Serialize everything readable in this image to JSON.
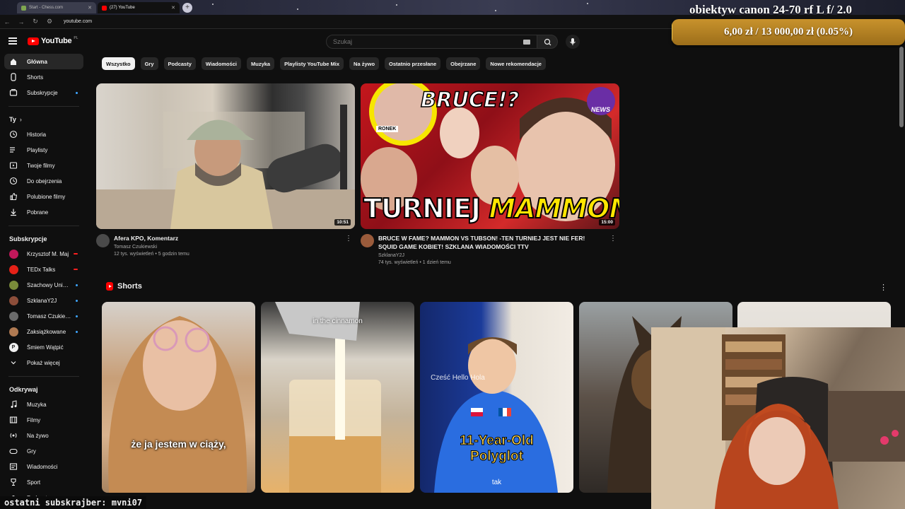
{
  "browser": {
    "tabs": [
      {
        "label": "Start - Chess.com",
        "active": false
      },
      {
        "label": "(27) YouTube",
        "active": true
      }
    ],
    "url": "youtube.com"
  },
  "overlay": {
    "title": "obiektyw canon 24-70 rf L f/ 2.0",
    "goal_text": "6,00 zł / 13 000,00 zł (0.05%)",
    "goal_progress_percent": 0.05,
    "last_subscriber": "ostatni subskrajber: mvni07"
  },
  "youtube": {
    "logo": "YouTube",
    "country_code": "PL",
    "search_placeholder": "Szukaj"
  },
  "sidebar": {
    "main": [
      {
        "label": "Główna",
        "icon": "home-icon",
        "active": true
      },
      {
        "label": "Shorts",
        "icon": "shorts-icon"
      },
      {
        "label": "Subskrypcje",
        "icon": "subscriptions-icon",
        "dot": true
      }
    ],
    "you_heading": "Ty",
    "you": [
      {
        "label": "Historia",
        "icon": "history-icon"
      },
      {
        "label": "Playlisty",
        "icon": "playlists-icon"
      },
      {
        "label": "Twoje filmy",
        "icon": "your-videos-icon"
      },
      {
        "label": "Do obejrzenia",
        "icon": "watch-later-icon"
      },
      {
        "label": "Polubione filmy",
        "icon": "like-icon"
      },
      {
        "label": "Pobrane",
        "icon": "download-icon"
      }
    ],
    "subs_heading": "Subskrypcje",
    "subs": [
      {
        "label": "Krzysztof M. Maj",
        "color": "#c2185b",
        "live": true
      },
      {
        "label": "TEDx Talks",
        "color": "#e62117",
        "live": true
      },
      {
        "label": "Szachowy Uniwe...",
        "color": "#7a8b3a",
        "dot": true
      },
      {
        "label": "SzklanaY2J",
        "color": "#8d4e3a",
        "dot": true
      },
      {
        "label": "Tomasz Czukiew...",
        "color": "#6b6b6b",
        "dot": true
      },
      {
        "label": "Zaksiążkowane",
        "color": "#b07a52",
        "dot": true
      },
      {
        "label": "Śmiem Wątpić",
        "color": "#f1f1f1",
        "letter": "P"
      },
      {
        "label": "Pokaż więcej",
        "icon": "chevron-down-icon"
      }
    ],
    "explore_heading": "Odkrywaj",
    "explore": [
      {
        "label": "Muzyka",
        "icon": "music-icon"
      },
      {
        "label": "Filmy",
        "icon": "movies-icon"
      },
      {
        "label": "Na żywo",
        "icon": "live-icon"
      },
      {
        "label": "Gry",
        "icon": "gaming-icon"
      },
      {
        "label": "Wiadomości",
        "icon": "news-icon"
      },
      {
        "label": "Sport",
        "icon": "sport-icon"
      },
      {
        "label": "Podcasty",
        "icon": "podcast-icon"
      }
    ]
  },
  "chips": [
    "Wszystko",
    "Gry",
    "Podcasty",
    "Wiadomości",
    "Muzyka",
    "Playlisty YouTube Mix",
    "Na żywo",
    "Ostatnio przesłane",
    "Obejrzane",
    "Nowe rekomendacje"
  ],
  "videos": [
    {
      "title": "Afera KPO, Komentarz",
      "channel": "Tomasz Czukiewski",
      "stats": "12 tys. wyświetleń • 5 godzin temu",
      "duration": "10:51"
    },
    {
      "title": "BRUCE W FAME? MAMMON VS TUBSON! -TEN TURNIEJ JEST NIE FER! SQUID GAME KOBIET! SZKLANA WIADOMOŚCI TTV",
      "channel": "SzklanaY2J",
      "stats": "74 tys. wyświetleń • 1 dzień temu",
      "duration": "15:00",
      "thumb_text_top": "BRUCE!?",
      "thumb_text_bottom_1": "TURNIEJ",
      "thumb_text_bottom_2": "MAMMONA?",
      "thumb_badge": "NEWS",
      "thumb_label": "RONEK"
    }
  ],
  "shorts": {
    "heading": "Shorts",
    "items": [
      {
        "caption": "że ja jestem w ciąży,"
      },
      {
        "caption": "in the cinnamon"
      },
      {
        "caption": "11-Year-Old Polyglot",
        "sub": "tak",
        "sign": "Cześć Hello Hola"
      },
      {
        "caption": ""
      },
      {
        "caption": ""
      }
    ]
  }
}
